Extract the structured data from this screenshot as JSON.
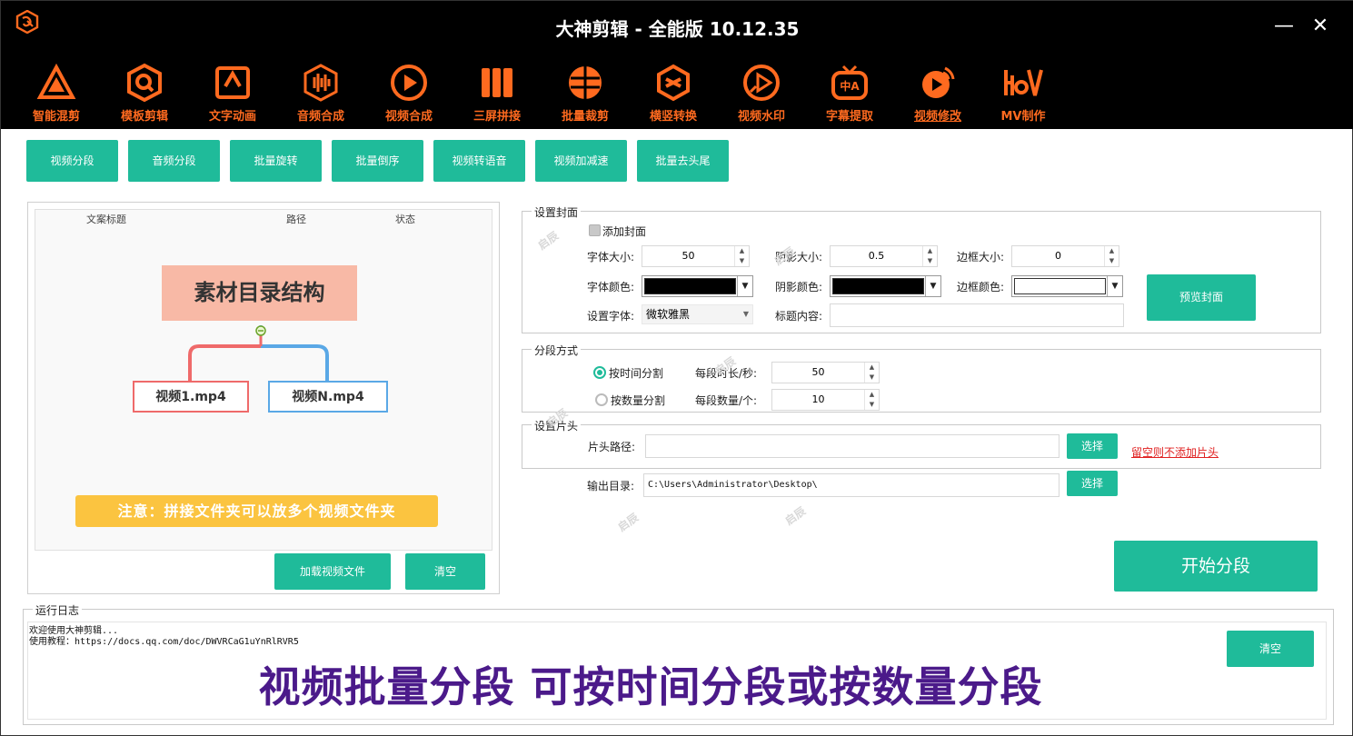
{
  "window": {
    "title": "大神剪辑 - 全能版 10.12.35",
    "minimize_glyph": "—",
    "close_glyph": "✕"
  },
  "colors": {
    "brand_orange": "#ff6a1f",
    "accent_teal": "#1fbb9a",
    "toolbar_bg": "#000000",
    "caption_purple": "#4b1a8a",
    "note_yellow": "#fbc440"
  },
  "toolbar": {
    "items": [
      {
        "label": "智能混剪",
        "icon": "triangle-logo-icon"
      },
      {
        "label": "模板剪辑",
        "icon": "hexagon-q-icon"
      },
      {
        "label": "文字动画",
        "icon": "text-frame-icon"
      },
      {
        "label": "音频合成",
        "icon": "audio-wave-icon"
      },
      {
        "label": "视频合成",
        "icon": "play-circle-icon"
      },
      {
        "label": "三屏拼接",
        "icon": "three-panel-icon"
      },
      {
        "label": "批量裁剪",
        "icon": "crop-circle-icon"
      },
      {
        "label": "横竖转换",
        "icon": "rotate-cube-icon"
      },
      {
        "label": "视频水印",
        "icon": "watermark-play-icon"
      },
      {
        "label": "字幕提取",
        "icon": "tv-subtitle-icon"
      },
      {
        "label": "视频修改",
        "icon": "broadcast-play-icon",
        "active": true
      },
      {
        "label": "MV制作",
        "icon": "mv-logo-icon"
      }
    ]
  },
  "subtabs": [
    "视频分段",
    "音频分段",
    "批量旋转",
    "批量倒序",
    "视频转语音",
    "视频加减速",
    "批量去头尾"
  ],
  "file_list": {
    "columns": [
      "文案标题",
      "路径",
      "状态"
    ],
    "diagram": {
      "title": "素材目录结构",
      "file1": "视频1.mp4",
      "fileN": "视频N.mp4",
      "note": "注意：拼接文件夹可以放多个视频文件夹"
    },
    "load_button": "加载视频文件",
    "clear_button": "清空"
  },
  "cover": {
    "group_title": "设置封面",
    "add_cover_label": "添加封面",
    "add_cover_checked": false,
    "font_size_label": "字体大小:",
    "font_size": "50",
    "shadow_size_label": "阴影大小:",
    "shadow_size": "0.5",
    "border_size_label": "边框大小:",
    "border_size": "0",
    "font_color_label": "字体颜色:",
    "font_color": "#000000",
    "shadow_color_label": "阴影颜色:",
    "shadow_color": "#000000",
    "border_color_label": "边框颜色:",
    "border_color": "#ffffff",
    "font_label": "设置字体:",
    "font_value": "微软雅黑",
    "title_content_label": "标题内容:",
    "title_content": "",
    "preview_button": "预览封面"
  },
  "segment": {
    "group_title": "分段方式",
    "by_time_label": "按时间分割",
    "by_count_label": "按数量分割",
    "selected": "time",
    "seconds_label": "每段时长/秒:",
    "seconds": "50",
    "count_label": "每段数量/个:",
    "count": "10"
  },
  "intro": {
    "group_title": "设置片头",
    "path_label": "片头路径:",
    "path": "",
    "select_button": "选择",
    "hint": "留空则不添加片头"
  },
  "output": {
    "label": "输出目录:",
    "path": "C:\\Users\\Administrator\\Desktop\\",
    "select_button": "选择"
  },
  "start_button": "开始分段",
  "log": {
    "group_title": "运行日志",
    "lines": [
      "欢迎使用大神剪辑...",
      "使用教程：https://docs.qq.com/doc/DWVRCaG1uYnRlRVR5"
    ],
    "clear_button": "清空",
    "caption": "视频批量分段 可按时间分段或按数量分段"
  },
  "watermark": "启辰"
}
